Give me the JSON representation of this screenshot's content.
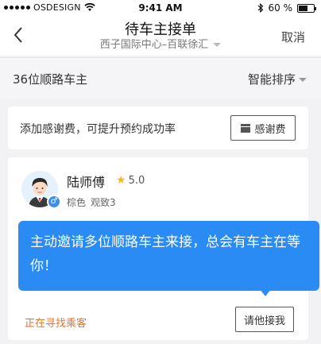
{
  "status_bar": {
    "carrier": "OSDESIGN",
    "time": "9:41 AM",
    "battery": "60 %",
    "battery_level": 0.6
  },
  "nav": {
    "title": "待车主接单",
    "subtitle": "西子国际中心–百联徐汇",
    "cancel_label": "取消"
  },
  "drivers_row": {
    "count_label": "36位顺路车主",
    "sort_label": "智能排序"
  },
  "thanks": {
    "text": "添加感谢费，可提升预约成功率",
    "button_label": "感谢费"
  },
  "driver": {
    "name": "陆师傅",
    "rating": "5.0",
    "car_color": "棕色",
    "car_model": "观致3",
    "gender_symbol": "♂"
  },
  "tooltip": {
    "text": "主动邀请多位顺路车主来接，总会有车主在等你！"
  },
  "footer": {
    "status": "正在寻找乘客",
    "invite_label": "请他接我"
  }
}
